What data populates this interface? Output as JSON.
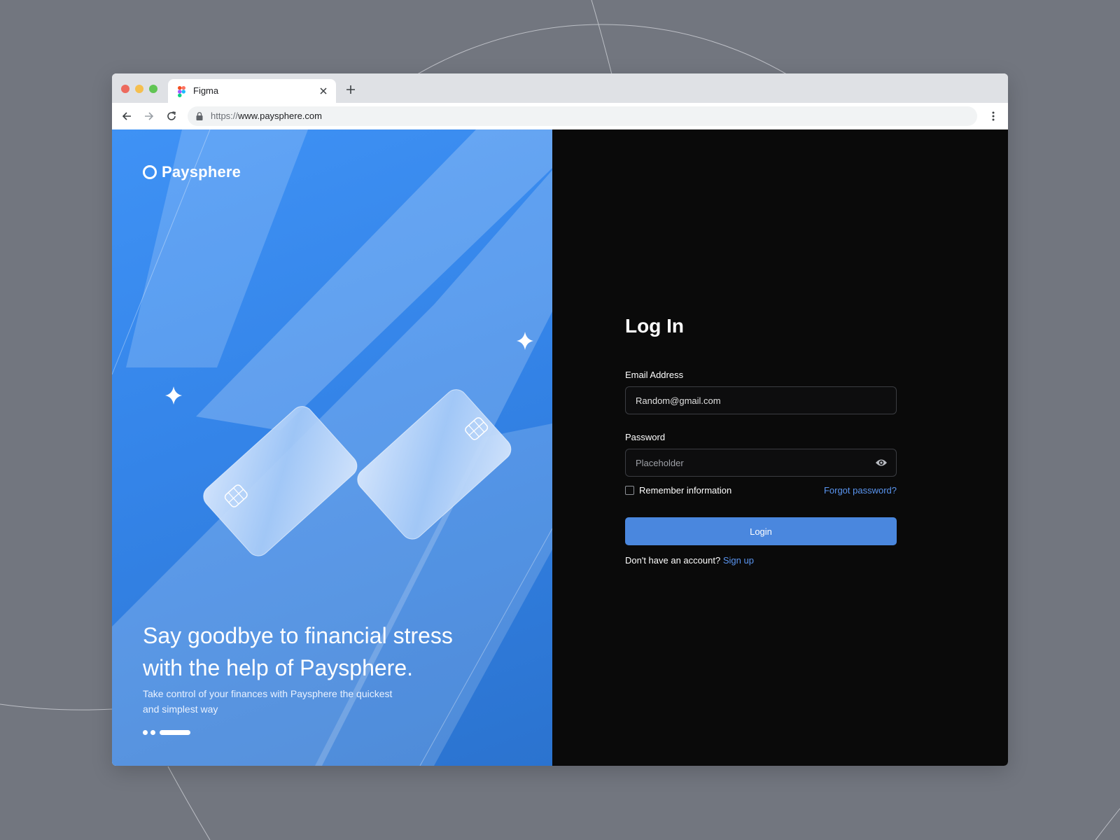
{
  "colors": {
    "page_background": "#72767f",
    "panel_blue": "#3484e8",
    "panel_dark": "#0a0a0a",
    "accent": "#4a87de",
    "link": "#5a95f0"
  },
  "browser": {
    "tab": {
      "favicon": "figma-icon",
      "title": "Figma",
      "close_icon": "close-icon"
    },
    "new_tab_icon": "plus-icon",
    "nav": {
      "back_icon": "arrow-left-icon",
      "forward_icon": "arrow-right-icon",
      "reload_icon": "reload-icon"
    },
    "address": {
      "lock_icon": "lock-icon",
      "scheme": "https://",
      "host": "www.paysphere.com"
    },
    "menu_icon": "kebab-menu-icon"
  },
  "hero": {
    "brand": "Paysphere",
    "headline": "Say goodbye to financial stress with the help of Paysphere.",
    "subtext": "Take control of your finances with Paysphere the quickest and simplest way"
  },
  "login": {
    "title": "Log In",
    "email_label": "Email Address",
    "email_value": "Random@gmail.com",
    "password_label": "Password",
    "password_placeholder": "Placeholder",
    "remember_label": "Remember information",
    "forgot_label": "Forgot password?",
    "login_button": "Login",
    "signup_prompt": "Don't have an account?",
    "signup_link": "Sign up"
  }
}
